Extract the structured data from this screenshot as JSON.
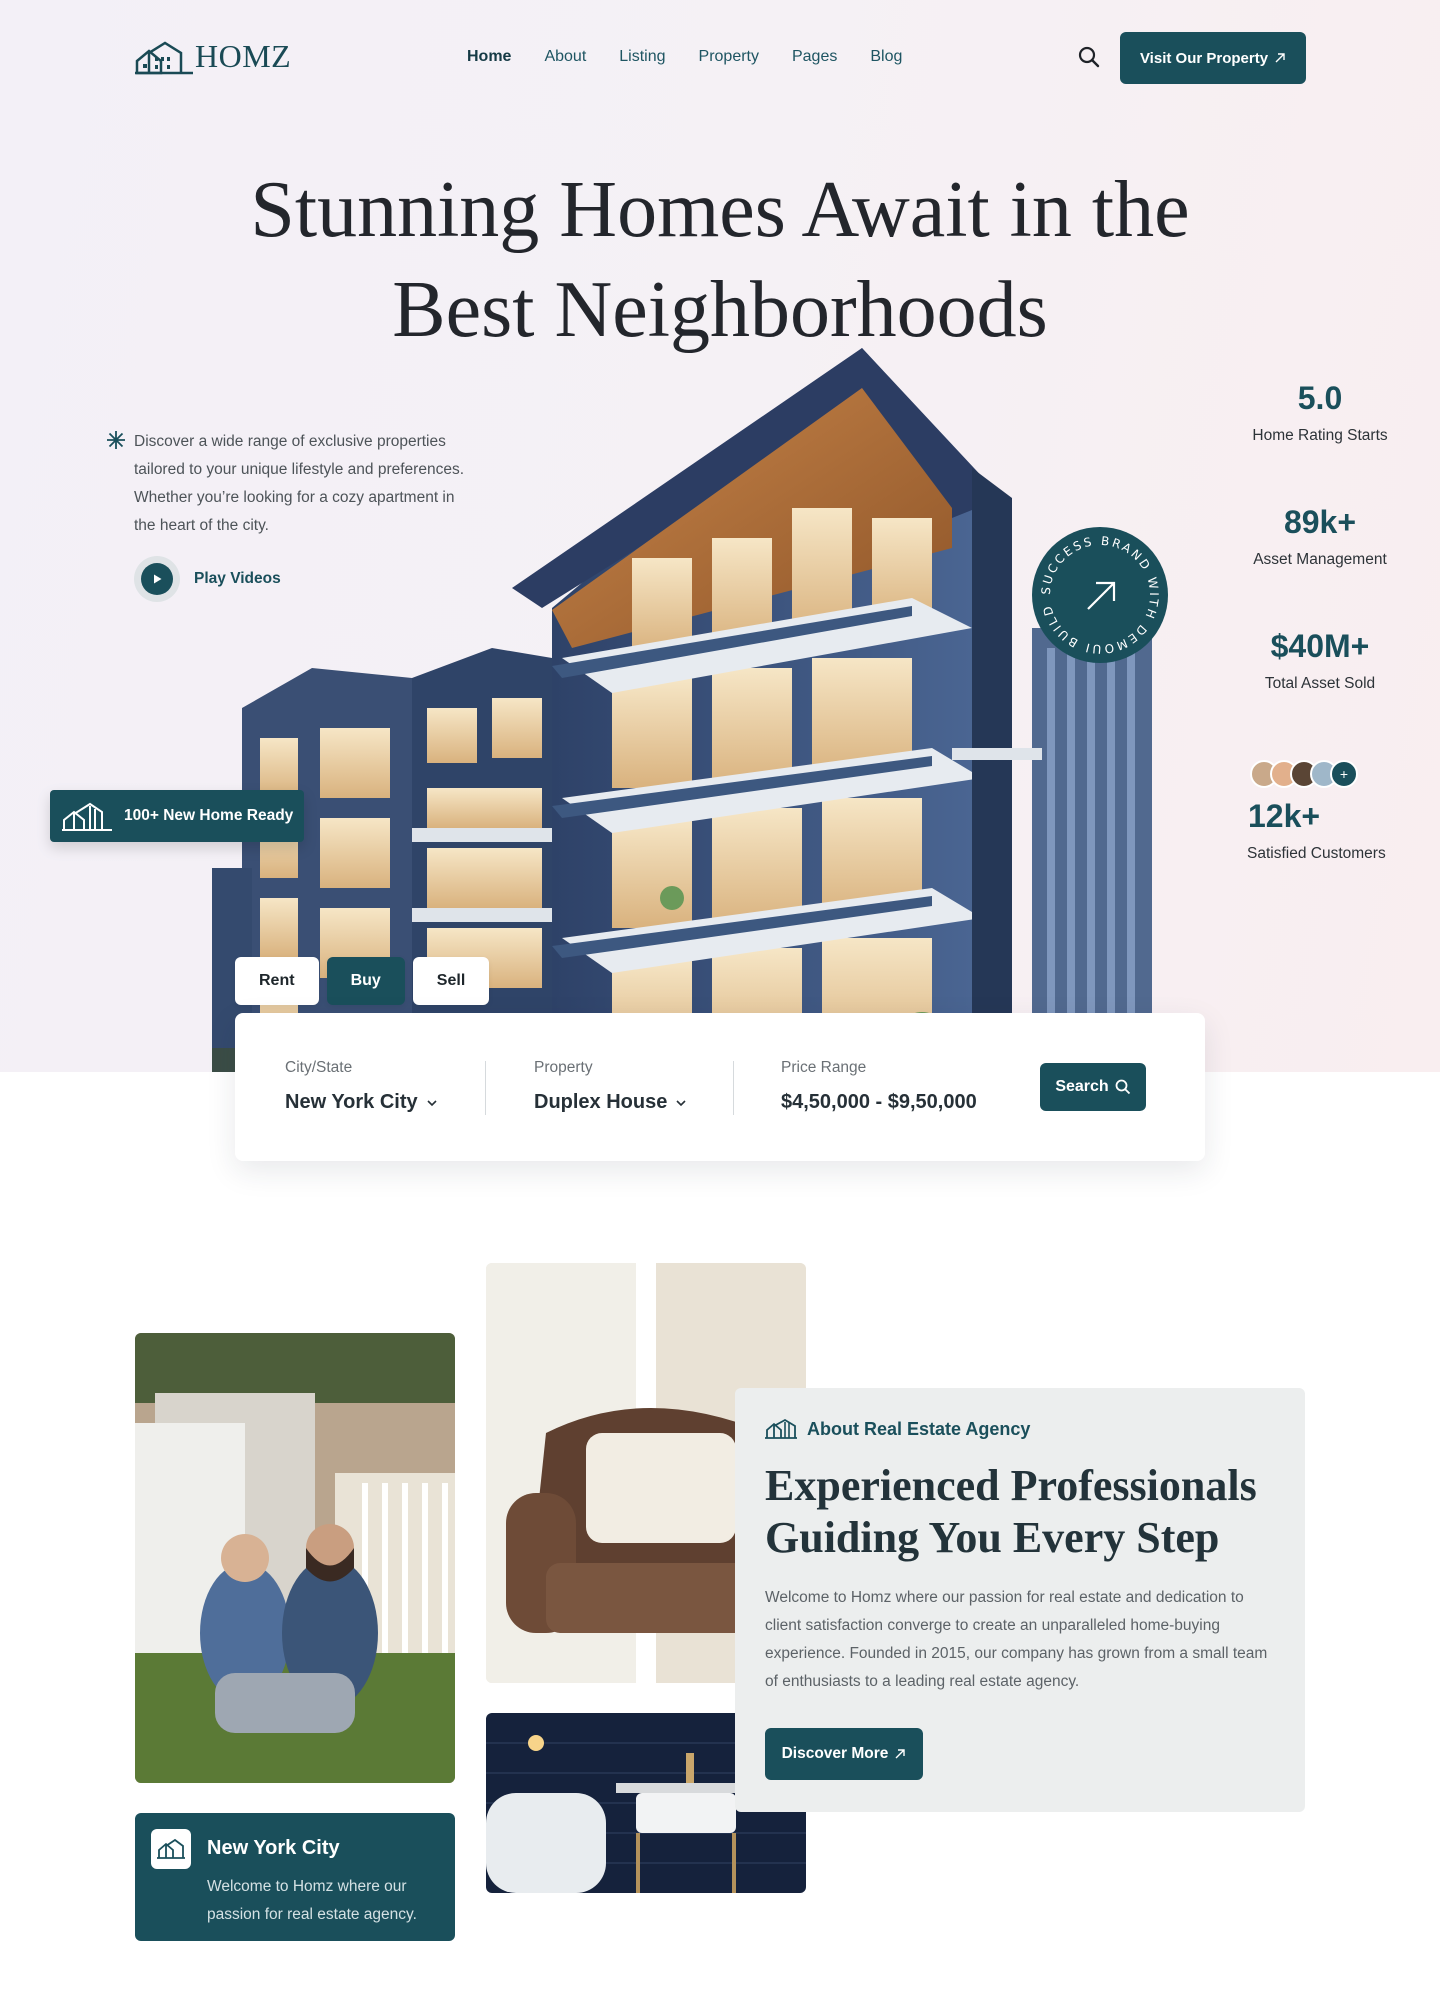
{
  "brand": {
    "name": "HOMZ"
  },
  "nav": {
    "items": [
      "Home",
      "About",
      "Listing",
      "Property",
      "Pages",
      "Blog"
    ],
    "active": "Home",
    "cta_label": "Visit Our Property"
  },
  "hero": {
    "title_line1": "Stunning Homes Await in the",
    "title_line2": "Best Neighborhoods",
    "intro": "Discover a wide range of exclusive properties tailored to your unique lifestyle and preferences. Whether you’re looking for a cozy apartment in the heart of the city.",
    "play_label": "Play Videos",
    "circle_badge_text": "SUCCESS BRAND WITH DEMOUI BUILD A",
    "new_badge": "100+ New Home Ready"
  },
  "stats": [
    {
      "value": "5.0",
      "label": "Home Rating Starts"
    },
    {
      "value": "89k+",
      "label": "Asset Management"
    },
    {
      "value": "$40M+",
      "label": "Total Asset Sold"
    },
    {
      "value": "12k+",
      "label": "Satisfied Customers"
    }
  ],
  "search": {
    "tabs": [
      "Rent",
      "Buy",
      "Sell"
    ],
    "active_tab": "Buy",
    "city_label": "City/State",
    "city_value": "New York City",
    "property_label": "Property",
    "property_value": "Duplex House",
    "price_label": "Price Range",
    "price_value": "$4,50,000 - $9,50,000",
    "button_label": "Search"
  },
  "city_card": {
    "title": "New York City",
    "desc": "Welcome to Homz where our passion for real estate agency."
  },
  "about": {
    "kicker": "About Real Estate Agency",
    "title": "Experienced Professionals Guiding You Every Step",
    "desc": "Welcome to Homz where our passion for real estate and dedication to client satisfaction converge to create an unparalleled home-buying experience. Founded in 2015, our company has grown from a small team of enthusiasts to a leading real estate agency.",
    "button_label": "Discover More"
  },
  "colors": {
    "primary": "#1a4f5b",
    "heading": "#23262c"
  }
}
